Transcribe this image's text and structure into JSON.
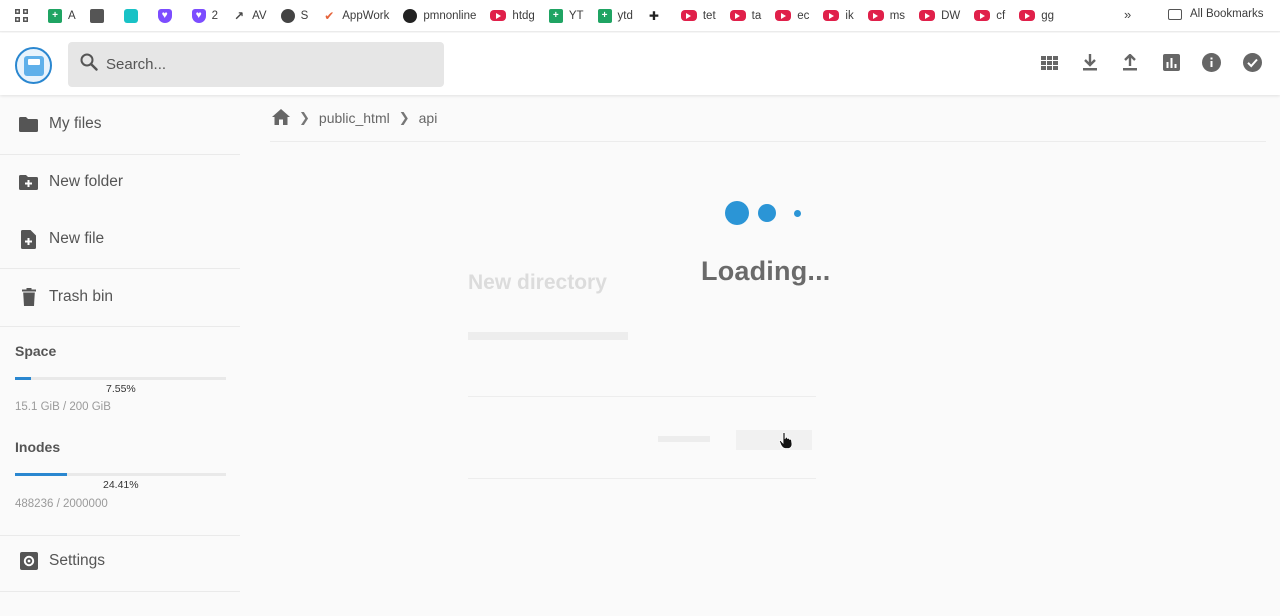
{
  "bookmarks": {
    "items": [
      {
        "label": "",
        "icon": "apps-grid-icon"
      },
      {
        "label": "A",
        "icon": "sheets-plus-icon"
      },
      {
        "label": "",
        "icon": "puzzle-icon"
      },
      {
        "label": "",
        "icon": "teal-square-icon"
      },
      {
        "label": "",
        "icon": "shield-heart-icon"
      },
      {
        "label": "2",
        "icon": "shield-heart-icon"
      },
      {
        "label": "AV",
        "icon": "trend-icon"
      },
      {
        "label": "S",
        "icon": "globe-icon"
      },
      {
        "label": "AppWork",
        "icon": "check-icon"
      },
      {
        "label": "pmnonline",
        "icon": "github-icon"
      },
      {
        "label": "htdg",
        "icon": "youtube-icon"
      },
      {
        "label": "YT",
        "icon": "sheets-plus-icon"
      },
      {
        "label": "ytd",
        "icon": "sheets-plus-icon"
      },
      {
        "label": "",
        "icon": "pin-icon"
      },
      {
        "label": "tet",
        "icon": "youtube-icon"
      },
      {
        "label": "ta",
        "icon": "youtube-icon"
      },
      {
        "label": "ec",
        "icon": "youtube-icon"
      },
      {
        "label": "ik",
        "icon": "youtube-icon"
      },
      {
        "label": "ms",
        "icon": "youtube-icon"
      },
      {
        "label": "DW",
        "icon": "youtube-icon"
      },
      {
        "label": "cf",
        "icon": "youtube-icon"
      },
      {
        "label": "gg",
        "icon": "youtube-icon"
      }
    ],
    "more": "»",
    "all_label": "All Bookmarks"
  },
  "header": {
    "search_placeholder": "Search...",
    "actions": [
      "grid-view-icon",
      "download-icon",
      "upload-icon",
      "chart-icon",
      "info-icon",
      "check-circle-icon"
    ]
  },
  "sidebar": {
    "items": [
      {
        "label": "My files",
        "icon": "folder-icon"
      },
      {
        "label": "New folder",
        "icon": "folder-plus-icon"
      },
      {
        "label": "New file",
        "icon": "file-plus-icon"
      },
      {
        "label": "Trash bin",
        "icon": "trash-icon"
      }
    ],
    "space": {
      "title": "Space",
      "percent": "7.55%",
      "fraction": 0.0755,
      "detail": "15.1 GiB / 200 GiB"
    },
    "inodes": {
      "title": "Inodes",
      "percent": "24.41%",
      "fraction": 0.2441,
      "detail": "488236 / 2000000"
    },
    "settings_label": "Settings"
  },
  "breadcrumb": {
    "parts": [
      "public_html",
      "api"
    ]
  },
  "dialog": {
    "title": "New directory"
  },
  "loader": {
    "text": "Loading...",
    "color": "#2b95d6"
  },
  "colors": {
    "accent": "#2a87d0"
  }
}
